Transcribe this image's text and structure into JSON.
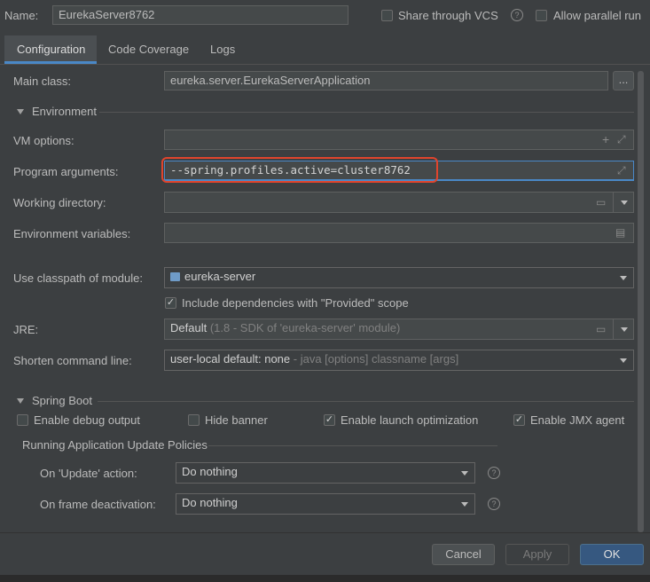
{
  "header": {
    "name_label": "Name:",
    "name_value": "EurekaServer8762",
    "share_vcs_label": "Share through VCS",
    "allow_parallel_label": "Allow parallel run"
  },
  "tabs": [
    {
      "label": "Configuration",
      "active": true
    },
    {
      "label": "Code Coverage",
      "active": false
    },
    {
      "label": "Logs",
      "active": false
    }
  ],
  "main_class": {
    "label": "Main class:",
    "value": "eureka.server.EurekaServerApplication",
    "browse": "..."
  },
  "environment": {
    "section_label": "Environment",
    "vm_options_label": "VM options:",
    "program_args_label": "Program arguments:",
    "program_args_value": "--spring.profiles.active=cluster8762",
    "working_dir_label": "Working directory:",
    "env_vars_label": "Environment variables:"
  },
  "classpath": {
    "label": "Use classpath of module:",
    "value": "eureka-server"
  },
  "include_deps": {
    "label": "Include dependencies with \"Provided\" scope",
    "checked": true
  },
  "jre": {
    "label": "JRE:",
    "value": "Default",
    "hint": "(1.8 - SDK of 'eureka-server' module)"
  },
  "shorten": {
    "label": "Shorten command line:",
    "value": "user-local default: none",
    "hint": "- java [options] classname [args]"
  },
  "spring_boot": {
    "section_label": "Spring Boot",
    "enable_debug": {
      "label": "Enable debug output",
      "checked": false
    },
    "hide_banner": {
      "label": "Hide banner",
      "checked": false
    },
    "launch_opt": {
      "label": "Enable launch optimization",
      "checked": true
    },
    "jmx_agent": {
      "label": "Enable JMX agent",
      "checked": true
    },
    "policies_label": "Running Application Update Policies",
    "update_action_label": "On 'Update' action:",
    "update_action_value": "Do nothing",
    "frame_deact_label": "On frame deactivation:",
    "frame_deact_value": "Do nothing"
  },
  "buttons": {
    "cancel": "Cancel",
    "apply": "Apply",
    "ok": "OK"
  },
  "colors": {
    "accent": "#4a88c7",
    "highlight": "#e0442d",
    "ok_button": "#365880"
  }
}
